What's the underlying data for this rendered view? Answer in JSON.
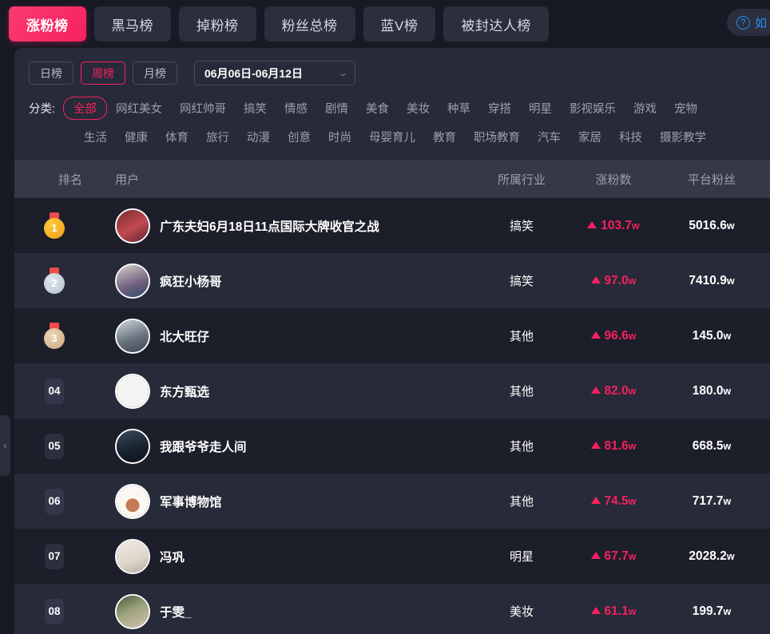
{
  "tabs": [
    {
      "label": "涨粉榜",
      "active": true
    },
    {
      "label": "黑马榜",
      "active": false
    },
    {
      "label": "掉粉榜",
      "active": false
    },
    {
      "label": "粉丝总榜",
      "active": false
    },
    {
      "label": "蓝V榜",
      "active": false
    },
    {
      "label": "被封达人榜",
      "active": false
    }
  ],
  "help": {
    "icon": "question-circle-icon",
    "label": "如"
  },
  "periods": [
    {
      "label": "日榜",
      "active": false
    },
    {
      "label": "周榜",
      "active": true
    },
    {
      "label": "月榜",
      "active": false
    }
  ],
  "date_range": {
    "value": "06月06日-06月12日",
    "chevron": "chevron-down-icon"
  },
  "categories": {
    "label": "分类:",
    "row1": [
      "全部",
      "网红美女",
      "网红帅哥",
      "搞笑",
      "情感",
      "剧情",
      "美食",
      "美妆",
      "种草",
      "穿搭",
      "明星",
      "影视娱乐",
      "游戏",
      "宠物"
    ],
    "row2": [
      "生活",
      "健康",
      "体育",
      "旅行",
      "动漫",
      "创意",
      "时尚",
      "母婴育儿",
      "教育",
      "职场教育",
      "汽车",
      "家居",
      "科技",
      "摄影教学"
    ],
    "active": "全部"
  },
  "table": {
    "headers": {
      "rank": "排名",
      "user": "用户",
      "industry": "所属行业",
      "growth": "涨粉数",
      "fans": "平台粉丝"
    },
    "rows": [
      {
        "rank": "1",
        "badge": "gold-medal",
        "name": "广东夫妇6月18日11点国际大牌收官之战",
        "industry": "搞笑",
        "growth": "103.7",
        "growth_unit": "w",
        "fans": "5016.6",
        "fans_unit": "w",
        "avatar": "couple-photo-avatar",
        "avatar_color": "#8c3a3a"
      },
      {
        "rank": "2",
        "badge": "silver-medal",
        "name": "疯狂小杨哥",
        "industry": "搞笑",
        "growth": "97.0",
        "growth_unit": "w",
        "fans": "7410.9",
        "fans_unit": "w",
        "avatar": "man-photo-avatar",
        "avatar_color": "#b6aeb8"
      },
      {
        "rank": "3",
        "badge": "bronze-medal",
        "name": "北大旺仔",
        "industry": "其他",
        "growth": "96.6",
        "growth_unit": "w",
        "fans": "145.0",
        "fans_unit": "w",
        "avatar": "man-photo-avatar",
        "avatar_color": "#9aa4ae"
      },
      {
        "rank": "04",
        "badge": "number",
        "name": "东方甄选",
        "industry": "其他",
        "growth": "82.0",
        "growth_unit": "w",
        "fans": "180.0",
        "fans_unit": "w",
        "avatar": "logo-avatar",
        "avatar_color": "#f2f2f2"
      },
      {
        "rank": "05",
        "badge": "number",
        "name": "我跟爷爷走人间",
        "industry": "其他",
        "growth": "81.6",
        "growth_unit": "w",
        "fans": "668.5",
        "fans_unit": "w",
        "avatar": "dark-photo-avatar",
        "avatar_color": "#24303f"
      },
      {
        "rank": "06",
        "badge": "number",
        "name": "军事博物馆",
        "industry": "其他",
        "growth": "74.5",
        "growth_unit": "w",
        "fans": "717.7",
        "fans_unit": "w",
        "avatar": "building-avatar",
        "avatar_color": "#f6f1ec"
      },
      {
        "rank": "07",
        "badge": "number",
        "name": "冯巩",
        "industry": "明星",
        "growth": "67.7",
        "growth_unit": "w",
        "fans": "2028.2",
        "fans_unit": "w",
        "avatar": "person-photo-avatar",
        "avatar_color": "#e8e4de"
      },
      {
        "rank": "08",
        "badge": "number",
        "name": "于雯_",
        "industry": "美妆",
        "growth": "61.1",
        "growth_unit": "w",
        "fans": "199.7",
        "fans_unit": "w",
        "avatar": "woman-photo-avatar",
        "avatar_color": "#6b7b55"
      }
    ]
  },
  "collapse_handle": {
    "icon": "chevron-left-icon",
    "label": "‹"
  },
  "colors": {
    "accent_pink": "#f5215f",
    "page_bg": "#171923",
    "panel_bg": "#272a38",
    "row_odd": "#1c1e2a",
    "header_bg": "#343847",
    "help_blue": "#2b8bf2"
  }
}
